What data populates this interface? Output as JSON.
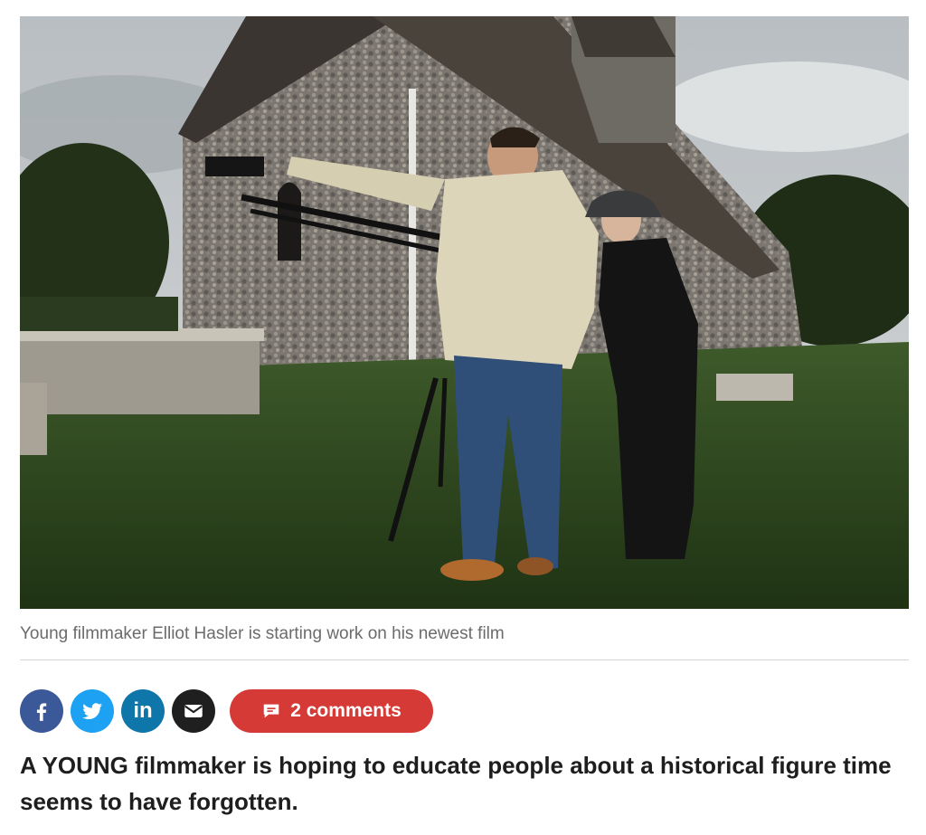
{
  "photo": {
    "alt": "Young filmmaker Elliot Hasler is starting work on his newest film",
    "caption": "Young filmmaker Elliot Hasler is starting work on his newest film"
  },
  "share": {
    "facebook_icon": "facebook-icon",
    "twitter_icon": "twitter-icon",
    "linkedin_icon": "linkedin-icon",
    "email_icon": "envelope-icon",
    "linkedin_glyph": "in",
    "colors": {
      "facebook": "#3b5998",
      "twitter": "#1da1f2",
      "linkedin": "#0e76a8",
      "email": "#1f1f1f"
    }
  },
  "comments": {
    "label": "2 comments",
    "icon": "comment-bubble-icon",
    "color": "#d63a36"
  },
  "article": {
    "lede": "A YOUNG filmmaker is hoping to educate people about a historical figure time seems to have forgotten."
  }
}
